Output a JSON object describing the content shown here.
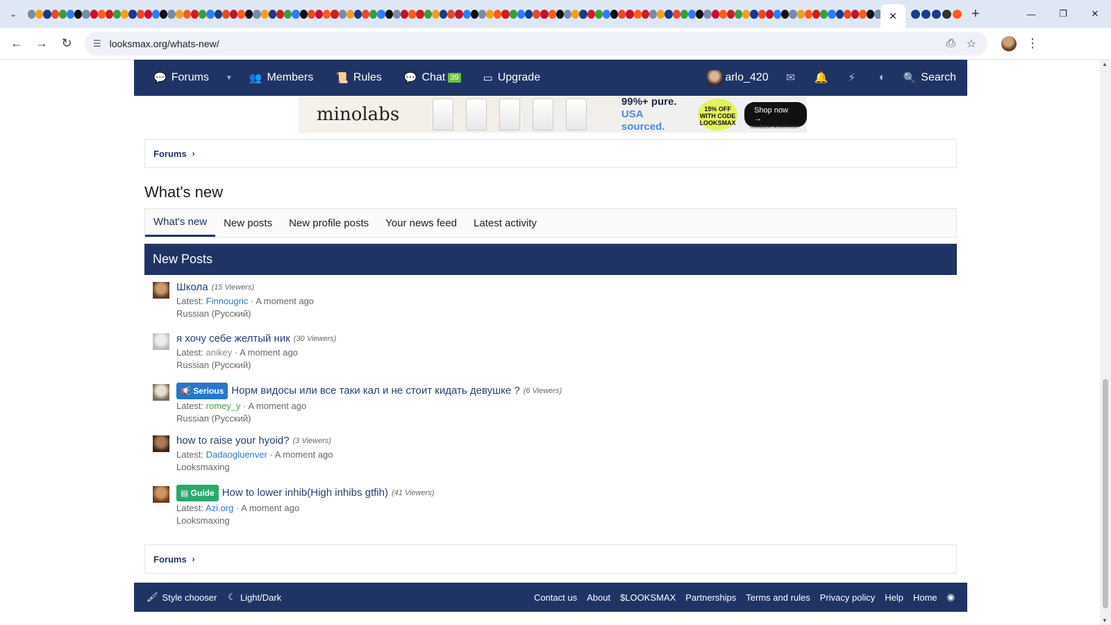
{
  "browser": {
    "url": "looksmax.org/whats-new/",
    "active_tab_close": "✕",
    "new_tab": "+"
  },
  "nav": {
    "forums": "Forums",
    "members": "Members",
    "rules": "Rules",
    "chat": "Chat",
    "chat_count": "39",
    "upgrade": "Upgrade",
    "username": "arlo_420",
    "search": "Search"
  },
  "banner": {
    "brand": "minolabs",
    "pure_line1": "99%+ pure.",
    "pure_line2": "USA sourced.",
    "discount": "15% OFF WITH CODE LOOKSMAX",
    "shop": "Shop now →",
    "url": "minolabsresearch.com"
  },
  "breadcrumb": {
    "label": "Forums"
  },
  "page": {
    "title": "What's new"
  },
  "tabs": [
    {
      "label": "What's new",
      "active": true
    },
    {
      "label": "New posts",
      "active": false
    },
    {
      "label": "New profile posts",
      "active": false
    },
    {
      "label": "Your news feed",
      "active": false
    },
    {
      "label": "Latest activity",
      "active": false
    }
  ],
  "block": {
    "title": "New Posts"
  },
  "posts": [
    {
      "prefix": "",
      "title": "Школа",
      "viewers": "(15 Viewers)",
      "latest_label": "Latest:",
      "user": "Finnougric",
      "time": "A moment ago",
      "forum": "Russian (Русский)"
    },
    {
      "prefix": "",
      "title": "я хочу себе желтый ник",
      "viewers": "(30 Viewers)",
      "latest_label": "Latest:",
      "user": "anikey",
      "time": "A moment ago",
      "forum": "Russian (Русский)"
    },
    {
      "prefix": "Serious",
      "title": "Норм видосы или все таки кал и не стоит кидать девушке ?",
      "viewers": "(6 Viewers)",
      "latest_label": "Latest:",
      "user": "romey_y",
      "time": "A moment ago",
      "forum": "Russian (Русский)"
    },
    {
      "prefix": "",
      "title": "how to raise your hyoid?",
      "viewers": "(3 Viewers)",
      "latest_label": "Latest:",
      "user": "Dadaogluenver",
      "time": "A moment ago",
      "forum": "Looksmaxing"
    },
    {
      "prefix": "Guide",
      "title": "How to lower inhib(High inhibs gtfih)",
      "viewers": "(41 Viewers)",
      "latest_label": "Latest:",
      "user": "Azi.org",
      "time": "A moment ago",
      "forum": "Looksmaxing"
    }
  ],
  "footer": {
    "style_chooser": "Style chooser",
    "light_dark": "Light/Dark",
    "links": [
      "Contact us",
      "About",
      "$LOOKSMAX",
      "Partnerships",
      "Terms and rules",
      "Privacy policy",
      "Help",
      "Home"
    ]
  },
  "colors": {
    "brand_navy": "#1f3465",
    "chat_badge": "#6cbf3f",
    "serious": "#2577c9",
    "guide": "#2ba86b"
  }
}
